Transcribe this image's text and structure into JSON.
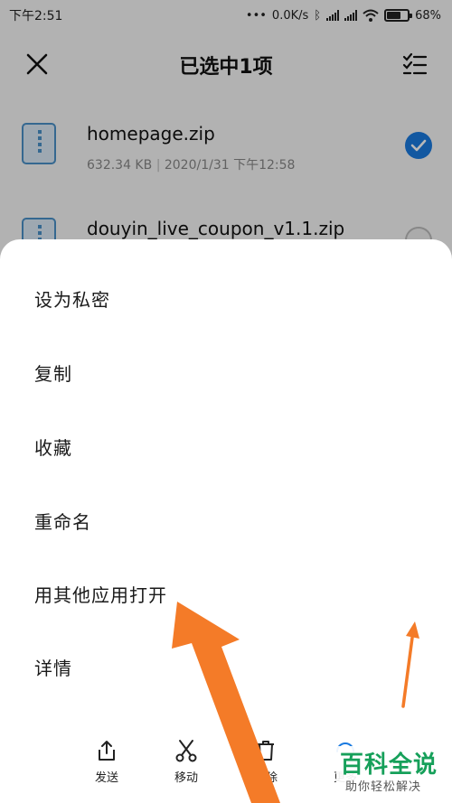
{
  "status_bar": {
    "time": "下午2:51",
    "network_speed": "0.0K/s",
    "battery": "68%",
    "battery_level": 0.68
  },
  "header": {
    "title": "已选中1项"
  },
  "files": [
    {
      "name": "homepage.zip",
      "size": "632.34 KB",
      "date": "2020/1/31 下午12:58",
      "selected": true
    },
    {
      "name": "douyin_live_coupon_v1.1.zip",
      "selected": false
    }
  ],
  "sheet": {
    "items": [
      "设为私密",
      "复制",
      "收藏",
      "重命名",
      "用其他应用打开",
      "详情"
    ]
  },
  "actions": [
    {
      "label": "发送",
      "icon": "share-icon"
    },
    {
      "label": "移动",
      "icon": "scissors-icon"
    },
    {
      "label": "删除",
      "icon": "trash-icon"
    },
    {
      "label": "更多",
      "icon": "more-icon"
    }
  ],
  "watermark": {
    "main": "百科全说",
    "sub": "助你轻松解决"
  },
  "colors": {
    "accent": "#1a7ae0",
    "arrow": "#f47b28",
    "watermark": "#16a05a"
  }
}
